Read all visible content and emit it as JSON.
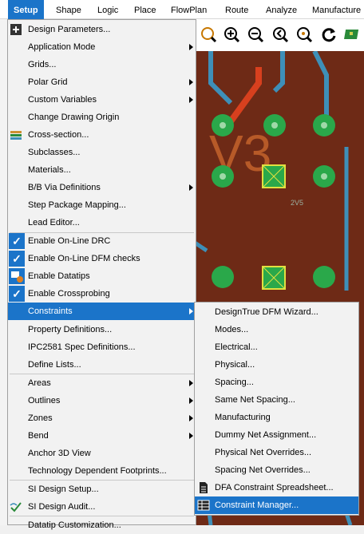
{
  "menubar": {
    "items": [
      "Setup",
      "Shape",
      "Logic",
      "Place",
      "FlowPlan",
      "Route",
      "Analyze",
      "Manufacture"
    ]
  },
  "canvas": {
    "label_big": "V3",
    "label_small": "2V5"
  },
  "setup_menu": {
    "items": [
      {
        "label": "Design Parameters...",
        "icon": "design-parameters-icon"
      },
      {
        "label": "Application Mode",
        "submenu": true
      },
      {
        "label": "Grids..."
      },
      {
        "label": "Polar Grid",
        "submenu": true
      },
      {
        "label": "Custom Variables",
        "submenu": true
      },
      {
        "label": "Change Drawing Origin"
      },
      {
        "label": "Cross-section...",
        "icon": "cross-section-icon"
      },
      {
        "label": "Subclasses..."
      },
      {
        "label": "Materials..."
      },
      {
        "label": "B/B Via Definitions",
        "submenu": true
      },
      {
        "label": "Step Package Mapping..."
      },
      {
        "label": "Lead Editor..."
      },
      {
        "label": "Enable On-Line DRC",
        "checked": true
      },
      {
        "label": "Enable On-Line DFM checks",
        "checked": true
      },
      {
        "label": "Enable Datatips",
        "icon": "datatips-icon"
      },
      {
        "label": "Enable Crossprobing",
        "checked": true
      },
      {
        "label": "Constraints",
        "submenu": true,
        "highlighted": true
      },
      {
        "label": "Property Definitions..."
      },
      {
        "label": "IPC2581 Spec Definitions..."
      },
      {
        "label": "Define Lists..."
      },
      {
        "label": "Areas",
        "submenu": true
      },
      {
        "label": "Outlines",
        "submenu": true
      },
      {
        "label": "Zones",
        "submenu": true
      },
      {
        "label": "Bend",
        "submenu": true
      },
      {
        "label": "Anchor 3D View"
      },
      {
        "label": "Technology Dependent Footprints..."
      },
      {
        "label": "SI Design Setup..."
      },
      {
        "label": "SI Design Audit...",
        "icon": "si-audit-icon"
      },
      {
        "label": "Datatip Customization..."
      }
    ]
  },
  "constraints_submenu": {
    "items": [
      {
        "label": "DesignTrue DFM Wizard..."
      },
      {
        "label": "Modes..."
      },
      {
        "label": "Electrical..."
      },
      {
        "label": "Physical..."
      },
      {
        "label": "Spacing..."
      },
      {
        "label": "Same Net Spacing..."
      },
      {
        "label": "Manufacturing"
      },
      {
        "label": "Dummy Net Assignment..."
      },
      {
        "label": "Physical Net Overrides..."
      },
      {
        "label": "Spacing Net Overrides..."
      },
      {
        "label": "DFA Constraint Spreadsheet...",
        "icon": "spreadsheet-icon"
      },
      {
        "label": "Constraint Manager...",
        "icon": "constraint-manager-icon",
        "highlighted": true
      }
    ]
  },
  "colors": {
    "highlight": "#1b74c9",
    "pcb_background": "#6e2a16",
    "via_green": "#2aa84a",
    "trace_blue": "#3e8fb8"
  }
}
